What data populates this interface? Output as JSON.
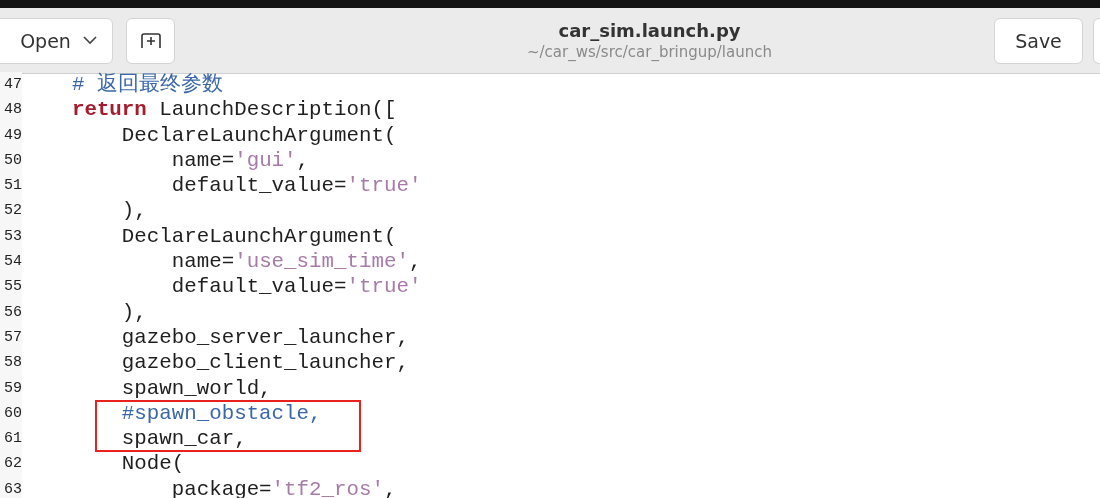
{
  "header": {
    "open_button": "Open",
    "title": "car_sim.launch.py",
    "path": "~/car_ws/src/car_bringup/launch",
    "save_button": "Save"
  },
  "lines": [
    {
      "number": "47",
      "boxed": false,
      "segments": [
        {
          "kind": "comment",
          "text": "    # 返回最终参数"
        }
      ]
    },
    {
      "number": "48",
      "boxed": false,
      "segments": [
        {
          "kind": "keyword",
          "text": "    return"
        },
        {
          "kind": "plain",
          "text": " LaunchDescription(["
        }
      ]
    },
    {
      "number": "49",
      "boxed": false,
      "segments": [
        {
          "kind": "plain",
          "text": "        DeclareLaunchArgument("
        }
      ]
    },
    {
      "number": "50",
      "boxed": false,
      "segments": [
        {
          "kind": "plain",
          "text": "            name="
        },
        {
          "kind": "string",
          "text": "'gui'"
        },
        {
          "kind": "plain",
          "text": ","
        }
      ]
    },
    {
      "number": "51",
      "boxed": false,
      "segments": [
        {
          "kind": "plain",
          "text": "            default_value="
        },
        {
          "kind": "string",
          "text": "'true'"
        }
      ]
    },
    {
      "number": "52",
      "boxed": false,
      "segments": [
        {
          "kind": "plain",
          "text": "        ),"
        }
      ]
    },
    {
      "number": "53",
      "boxed": false,
      "segments": [
        {
          "kind": "plain",
          "text": "        DeclareLaunchArgument("
        }
      ]
    },
    {
      "number": "54",
      "boxed": false,
      "segments": [
        {
          "kind": "plain",
          "text": "            name="
        },
        {
          "kind": "string",
          "text": "'use_sim_time'"
        },
        {
          "kind": "plain",
          "text": ","
        }
      ]
    },
    {
      "number": "55",
      "boxed": false,
      "segments": [
        {
          "kind": "plain",
          "text": "            default_value="
        },
        {
          "kind": "string",
          "text": "'true'"
        }
      ]
    },
    {
      "number": "56",
      "boxed": false,
      "segments": [
        {
          "kind": "plain",
          "text": "        ),"
        }
      ]
    },
    {
      "number": "57",
      "boxed": false,
      "segments": [
        {
          "kind": "plain",
          "text": "        gazebo_server_launcher,"
        }
      ]
    },
    {
      "number": "58",
      "boxed": false,
      "segments": [
        {
          "kind": "plain",
          "text": "        gazebo_client_launcher,"
        }
      ]
    },
    {
      "number": "59",
      "boxed": false,
      "segments": [
        {
          "kind": "plain",
          "text": "        spawn_world,"
        }
      ]
    },
    {
      "number": "60",
      "boxed": true,
      "segments": [
        {
          "kind": "comment",
          "text": "        #spawn_obstacle,"
        }
      ]
    },
    {
      "number": "61",
      "boxed": true,
      "segments": [
        {
          "kind": "plain",
          "text": "        spawn_car,"
        }
      ]
    },
    {
      "number": "62",
      "boxed": false,
      "segments": [
        {
          "kind": "plain",
          "text": "        Node("
        }
      ]
    },
    {
      "number": "63",
      "boxed": false,
      "segments": [
        {
          "kind": "plain",
          "text": "            package="
        },
        {
          "kind": "string",
          "text": "'tf2_ros'"
        },
        {
          "kind": "plain",
          "text": ","
        }
      ]
    }
  ]
}
